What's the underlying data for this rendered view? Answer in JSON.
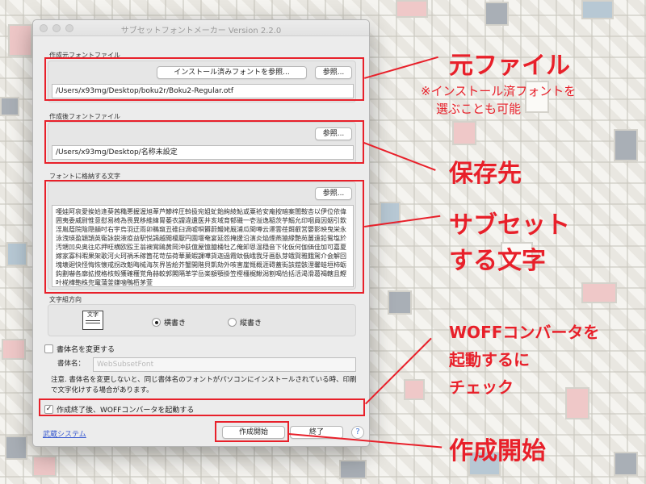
{
  "window": {
    "title": "サブセットフォントメーカー Version 2.2.0"
  },
  "source_font": {
    "label": "作成元フォントファイル",
    "installed_button": "インストール済みフォントを参照...",
    "browse_button": "参照...",
    "path": "/Users/x93mg/Desktop/boku2r/Boku2-Regular.otf"
  },
  "output_font": {
    "label": "作成後フォントファイル",
    "browse_button": "参照...",
    "path": "/Users/x93mg/Desktop/名称未設定"
  },
  "characters": {
    "label": "フォントに格納する文字",
    "browse_button": "参照...",
    "text": "唖娃阿哀愛挨姶逢葵茜穐悪握渥旭葦芦鯵梓圧斡扱宛姐虻飴絢綾鮎或粟袷安庵按暗案闇鞍杏以伊位依偉囲夷委威尉惟意慰易椅為畏異移維緯胃萎衣謂違遺医井亥域育郁磯一壱溢逸稲茨芋鰯允印咽員因姻引飲淫胤蔭院陰隠韻吋右宇烏羽迂雨卯鵜窺丑碓臼渦嘘唄欝蔚鰻姥厩浦瓜閏噂云運雲荏餌叡営嬰影映曳栄永泳洩瑛盈穎頴英衛詠鋭液疫益駅悦謁越閲榎厭円園堰奄宴延怨掩援沿演炎焔煙燕猿縁艶苑薗遠鉛鴛塩於汚甥凹央奥往応押旺横欧殴王翁襖鴬鴎黄岡沖荻億屋憶臆桶牡乙俺卸恩温穏音下化仮何伽価佳加可嘉夏嫁家寡科暇果架歌河火珂禍禾稼箇花苛茄荷華菓蝦課嘩貨迦過霞蚊俄峨我牙画臥芽蛾賀雅餓駕介会解回塊壊廻快怪悔恢懐戒拐改魁晦械海灰界皆絵芥蟹開階貝凱劾外咳害崖慨概涯碍蓋街該鎧骸浬馨蛙垣柿蛎鈎劃嚇各廓拡撹格核殻獲確穫覚角赫較郭閣隔革学岳楽額顎掛笠樫橿梶鰍潟割喝恰括活渇滑葛褐轄且鰹叶椛樺鞄株兜竃蒲釜鎌噛鴨栢茅萱"
  },
  "direction": {
    "label": "文字組方向",
    "icon_text": "文字",
    "horizontal": "横書き",
    "vertical": "縦書き",
    "selected": "horizontal"
  },
  "rename": {
    "checkbox_label": "書体名を変更する",
    "checked": false,
    "name_label": "書体名：",
    "name_placeholder": "WebSubsetFont",
    "note": "注意. 書体名を変更しないと、同じ書体名のフォントがパソコンにインストールされている時、印刷で文字化けする場合があります。"
  },
  "woff": {
    "checkbox_label": "作成終了後、WOFFコンバータを起動する",
    "checked": true,
    "check_mark": "✓"
  },
  "footer": {
    "link": "武蔵システム",
    "start_button": "作成開始",
    "quit_button": "終了",
    "help": "?"
  },
  "annotations": {
    "source": "元ファイル",
    "source_note_1": "※インストール済フォントを",
    "source_note_2": "選ぶことも可能",
    "output": "保存先",
    "subset_1": "サブセット",
    "subset_2": "する文字",
    "woff_1": "WOFFコンバータを",
    "woff_2": "起動するに",
    "woff_3": "チェック",
    "start": "作成開始"
  },
  "colors": {
    "accent_red": "#e8202a",
    "link_blue": "#3a5bd1"
  }
}
